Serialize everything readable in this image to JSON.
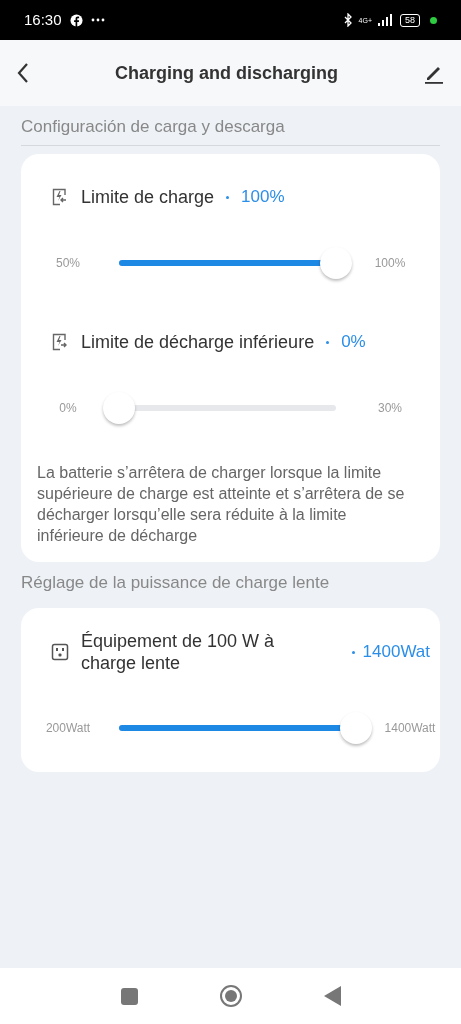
{
  "status_bar": {
    "time": "16:30",
    "network": "4G+",
    "battery": "58"
  },
  "header": {
    "title": "Charging and discharging"
  },
  "sections": [
    {
      "title": "Configuración de carga y descarga",
      "settings": [
        {
          "kind": "charge",
          "label": "Limite de charge",
          "value": "100%",
          "min": "50%",
          "max": "100%",
          "level": 1
        },
        {
          "kind": "discharge",
          "label": "Limite de décharge inférieure",
          "value": "0%",
          "min": "0%",
          "max": "30%",
          "level": 0
        }
      ],
      "note": "La batterie s’arrêtera de charger lorsque la limite supérieure de charge est atteinte et s’arrêtera de se décharger lorsqu’elle sera réduite à la limite inférieure de décharge"
    },
    {
      "title": "Réglage de la puissance de charge lente",
      "settings": [
        {
          "kind": "outlet",
          "label": "Équipement de 100 W à charge lente",
          "value": "1400Wat",
          "min": "200Watt",
          "max": "1400Watt",
          "level": 1
        }
      ]
    }
  ]
}
